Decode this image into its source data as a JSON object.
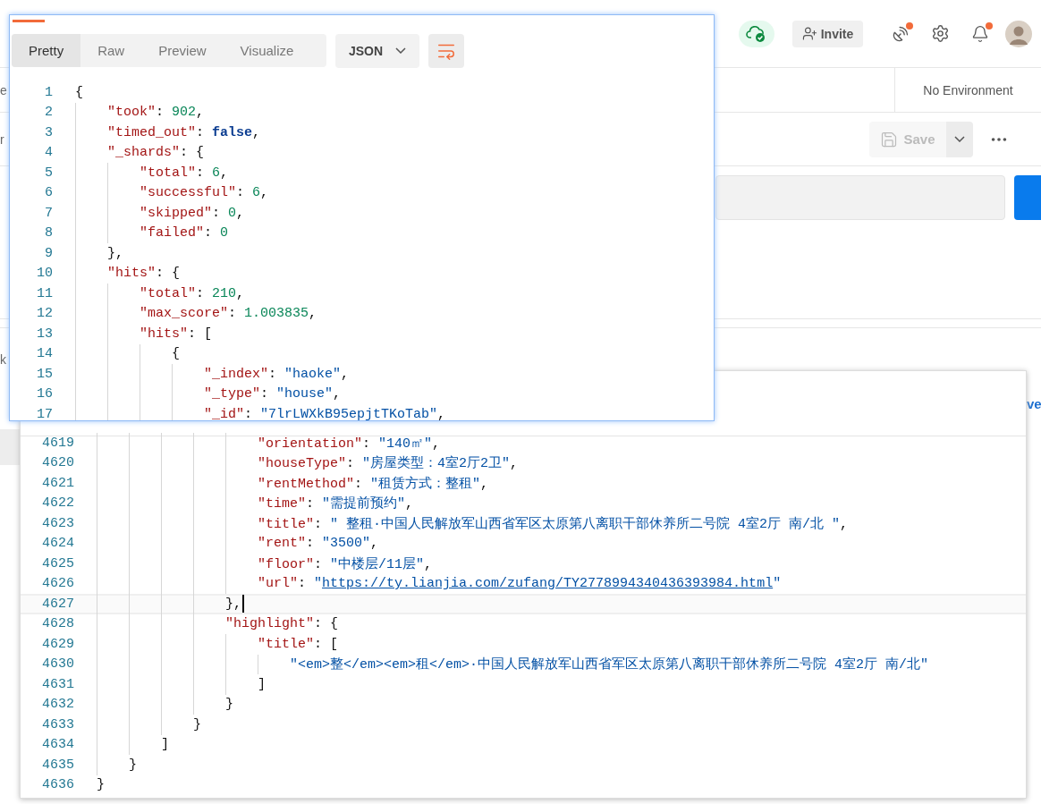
{
  "topbar": {
    "invite": "Invite",
    "icons": [
      {
        "kind": "satellite",
        "badge": true
      },
      {
        "kind": "settings",
        "badge": false
      },
      {
        "kind": "bell",
        "badge": true
      }
    ]
  },
  "environment": "No Environment",
  "left_fragments": [
    "e",
    "r",
    "k"
  ],
  "right_fragment": "ve",
  "save": {
    "label": "Save",
    "disabled": true
  },
  "response_viewer": {
    "tabs": [
      {
        "label": "Pretty",
        "selected": true
      },
      {
        "label": "Raw",
        "selected": false
      },
      {
        "label": "Preview",
        "selected": false
      },
      {
        "label": "Visualize",
        "selected": false
      }
    ],
    "format": "JSON",
    "lines": [
      {
        "number": "1",
        "tokens": [
          {
            "kind": "punct",
            "text": "{"
          }
        ]
      },
      {
        "number": "2",
        "tokens": [
          {
            "kind": "key",
            "text": "    \"took\""
          },
          {
            "kind": "punct",
            "text": ": "
          },
          {
            "kind": "number",
            "text": "902"
          },
          {
            "kind": "punct",
            "text": ","
          }
        ]
      },
      {
        "number": "3",
        "tokens": [
          {
            "kind": "key",
            "text": "    \"timed_out\""
          },
          {
            "kind": "punct",
            "text": ": "
          },
          {
            "kind": "bool",
            "text": "false"
          },
          {
            "kind": "punct",
            "text": ","
          }
        ]
      },
      {
        "number": "4",
        "tokens": [
          {
            "kind": "key",
            "text": "    \"_shards\""
          },
          {
            "kind": "punct",
            "text": ": {"
          }
        ]
      },
      {
        "number": "5",
        "tokens": [
          {
            "kind": "key",
            "text": "        \"total\""
          },
          {
            "kind": "punct",
            "text": ": "
          },
          {
            "kind": "number",
            "text": "6"
          },
          {
            "kind": "punct",
            "text": ","
          }
        ]
      },
      {
        "number": "6",
        "tokens": [
          {
            "kind": "key",
            "text": "        \"successful\""
          },
          {
            "kind": "punct",
            "text": ": "
          },
          {
            "kind": "number",
            "text": "6"
          },
          {
            "kind": "punct",
            "text": ","
          }
        ]
      },
      {
        "number": "7",
        "tokens": [
          {
            "kind": "key",
            "text": "        \"skipped\""
          },
          {
            "kind": "punct",
            "text": ": "
          },
          {
            "kind": "number",
            "text": "0"
          },
          {
            "kind": "punct",
            "text": ","
          }
        ]
      },
      {
        "number": "8",
        "tokens": [
          {
            "kind": "key",
            "text": "        \"failed\""
          },
          {
            "kind": "punct",
            "text": ": "
          },
          {
            "kind": "number",
            "text": "0"
          }
        ]
      },
      {
        "number": "9",
        "tokens": [
          {
            "kind": "punct",
            "text": "    },"
          }
        ]
      },
      {
        "number": "10",
        "tokens": [
          {
            "kind": "key",
            "text": "    \"hits\""
          },
          {
            "kind": "punct",
            "text": ": {"
          }
        ]
      },
      {
        "number": "11",
        "tokens": [
          {
            "kind": "key",
            "text": "        \"total\""
          },
          {
            "kind": "punct",
            "text": ": "
          },
          {
            "kind": "number",
            "text": "210"
          },
          {
            "kind": "punct",
            "text": ","
          }
        ]
      },
      {
        "number": "12",
        "tokens": [
          {
            "kind": "key",
            "text": "        \"max_score\""
          },
          {
            "kind": "punct",
            "text": ": "
          },
          {
            "kind": "number",
            "text": "1.003835"
          },
          {
            "kind": "punct",
            "text": ","
          }
        ]
      },
      {
        "number": "13",
        "tokens": [
          {
            "kind": "key",
            "text": "        \"hits\""
          },
          {
            "kind": "punct",
            "text": ": ["
          }
        ]
      },
      {
        "number": "14",
        "tokens": [
          {
            "kind": "punct",
            "text": "            {"
          }
        ]
      },
      {
        "number": "15",
        "tokens": [
          {
            "kind": "key",
            "text": "                \"_index\""
          },
          {
            "kind": "punct",
            "text": ": "
          },
          {
            "kind": "string",
            "text": "\"haoke\""
          },
          {
            "kind": "punct",
            "text": ","
          }
        ]
      },
      {
        "number": "16",
        "tokens": [
          {
            "kind": "key",
            "text": "                \"_type\""
          },
          {
            "kind": "punct",
            "text": ": "
          },
          {
            "kind": "string",
            "text": "\"house\""
          },
          {
            "kind": "punct",
            "text": ","
          }
        ]
      },
      {
        "number": "17",
        "tokens": [
          {
            "kind": "key",
            "text": "                \"_id\""
          },
          {
            "kind": "punct",
            "text": ": "
          },
          {
            "kind": "string",
            "text": "\"7lrLWXkB95epjtTKoTab\""
          },
          {
            "kind": "punct",
            "text": ","
          }
        ]
      }
    ]
  },
  "editor": {
    "lines": [
      {
        "number": "4619",
        "current": false,
        "tokens": [
          {
            "kind": "key",
            "text": "                    \"orientation\""
          },
          {
            "kind": "punct",
            "text": ": "
          },
          {
            "kind": "string",
            "text": "\"140㎡\""
          },
          {
            "kind": "punct",
            "text": ","
          }
        ]
      },
      {
        "number": "4620",
        "current": false,
        "tokens": [
          {
            "kind": "key",
            "text": "                    \"houseType\""
          },
          {
            "kind": "punct",
            "text": ": "
          },
          {
            "kind": "string",
            "text": "\"房屋类型：4室2厅2卫\""
          },
          {
            "kind": "punct",
            "text": ","
          }
        ]
      },
      {
        "number": "4621",
        "current": false,
        "tokens": [
          {
            "kind": "key",
            "text": "                    \"rentMethod\""
          },
          {
            "kind": "punct",
            "text": ": "
          },
          {
            "kind": "string",
            "text": "\"租赁方式：整租\""
          },
          {
            "kind": "punct",
            "text": ","
          }
        ]
      },
      {
        "number": "4622",
        "current": false,
        "tokens": [
          {
            "kind": "key",
            "text": "                    \"time\""
          },
          {
            "kind": "punct",
            "text": ": "
          },
          {
            "kind": "string",
            "text": "\"需提前预约\""
          },
          {
            "kind": "punct",
            "text": ","
          }
        ]
      },
      {
        "number": "4623",
        "current": false,
        "tokens": [
          {
            "kind": "key",
            "text": "                    \"title\""
          },
          {
            "kind": "punct",
            "text": ": "
          },
          {
            "kind": "string",
            "text": "\" 整租·中国人民解放军山西省军区太原第八离职干部休养所二号院 4室2厅 南/北 \""
          },
          {
            "kind": "punct",
            "text": ","
          }
        ]
      },
      {
        "number": "4624",
        "current": false,
        "tokens": [
          {
            "kind": "key",
            "text": "                    \"rent\""
          },
          {
            "kind": "punct",
            "text": ": "
          },
          {
            "kind": "string",
            "text": "\"3500\""
          },
          {
            "kind": "punct",
            "text": ","
          }
        ]
      },
      {
        "number": "4625",
        "current": false,
        "tokens": [
          {
            "kind": "key",
            "text": "                    \"floor\""
          },
          {
            "kind": "punct",
            "text": ": "
          },
          {
            "kind": "string",
            "text": "\"中楼层/11层\""
          },
          {
            "kind": "punct",
            "text": ","
          }
        ]
      },
      {
        "number": "4626",
        "current": false,
        "tokens": [
          {
            "kind": "key",
            "text": "                    \"url\""
          },
          {
            "kind": "punct",
            "text": ": "
          },
          {
            "kind": "string",
            "text": "\""
          },
          {
            "kind": "link",
            "text": "https://ty.lianjia.com/zufang/TY2778994340436393984.html"
          },
          {
            "kind": "string",
            "text": "\""
          }
        ]
      },
      {
        "number": "4627",
        "current": true,
        "tokens": [
          {
            "kind": "punct",
            "text": "                },"
          }
        ]
      },
      {
        "number": "4628",
        "current": false,
        "tokens": [
          {
            "kind": "key",
            "text": "                \"highlight\""
          },
          {
            "kind": "punct",
            "text": ": {"
          }
        ]
      },
      {
        "number": "4629",
        "current": false,
        "tokens": [
          {
            "kind": "key",
            "text": "                    \"title\""
          },
          {
            "kind": "punct",
            "text": ": ["
          }
        ]
      },
      {
        "number": "4630",
        "current": false,
        "tokens": [
          {
            "kind": "string",
            "text": "                        \"<em>整</em><em>租</em>·中国人民解放军山西省军区太原第八离职干部休养所二号院 4室2厅 南/北\""
          }
        ]
      },
      {
        "number": "4631",
        "current": false,
        "tokens": [
          {
            "kind": "punct",
            "text": "                    ]"
          }
        ]
      },
      {
        "number": "4632",
        "current": false,
        "tokens": [
          {
            "kind": "punct",
            "text": "                }"
          }
        ]
      },
      {
        "number": "4633",
        "current": false,
        "tokens": [
          {
            "kind": "punct",
            "text": "            }"
          }
        ]
      },
      {
        "number": "4634",
        "current": false,
        "tokens": [
          {
            "kind": "punct",
            "text": "        ]"
          }
        ]
      },
      {
        "number": "4635",
        "current": false,
        "tokens": [
          {
            "kind": "punct",
            "text": "    }"
          }
        ]
      },
      {
        "number": "4636",
        "current": false,
        "tokens": [
          {
            "kind": "punct",
            "text": "}"
          }
        ]
      }
    ]
  }
}
